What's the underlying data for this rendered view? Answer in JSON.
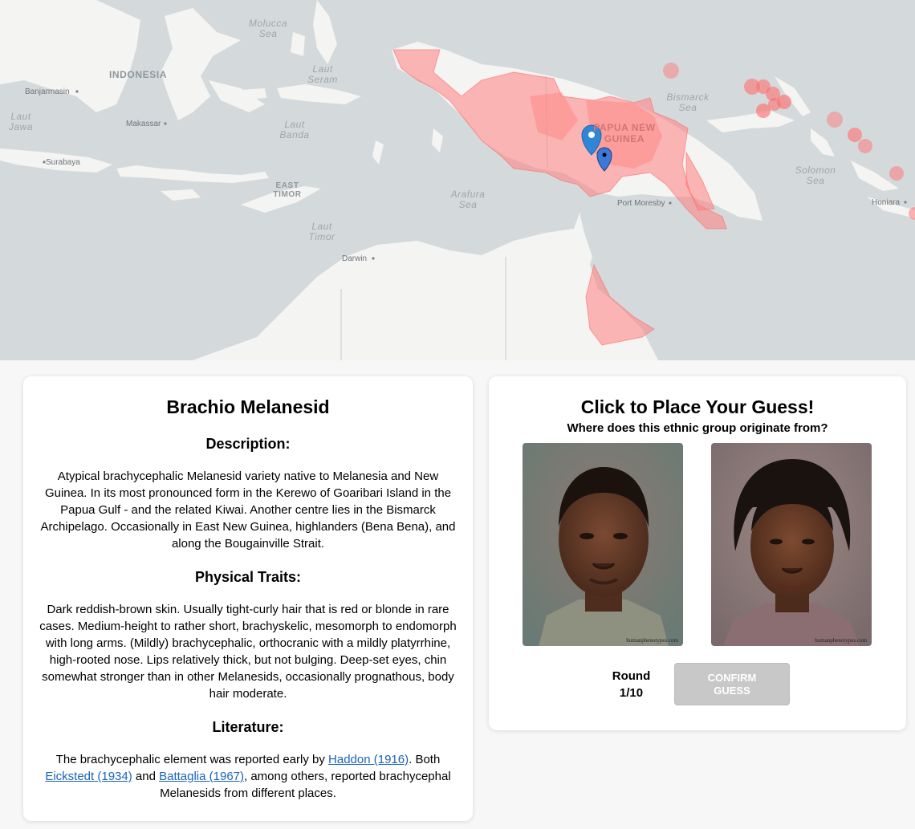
{
  "map": {
    "labels": {
      "molucca": "Molucca\nSea",
      "indonesia": "INDONESIA",
      "banjarmasin": "Banjarmasin",
      "laut_jawa": "Laut\nJawa",
      "makassar": "Makassar",
      "laut_seram": "Laut\nSeram",
      "laut_banda": "Laut\nBanda",
      "surabaya": "Surabaya",
      "east_timor": "EAST\nTIMOR",
      "laut_timor": "Laut\nTimor",
      "arafura": "Arafura\nSea",
      "darwin": "Darwin",
      "png": "PAPUA NEW\nGUINEA",
      "bismarck": "Bismarck\nSea",
      "solomon": "Solomon\nSea",
      "port_moresby": "Port Moresby",
      "honiara": "Honiara"
    },
    "region_color": "#ff8080",
    "marker_color": "#2f86d6"
  },
  "info": {
    "title": "Brachio Melanesid",
    "description_heading": "Description:",
    "description": "Atypical brachycephalic Melanesid variety native to Melanesia and New Guinea. In its most pronounced form in the Kerewo of Goaribari Island in the Papua Gulf - and the related Kiwai. Another centre lies in the Bismarck Archipelago. Occasionally in East New Guinea, highlanders (Bena Bena), and along the Bougainville Strait.",
    "traits_heading": "Physical Traits:",
    "traits": "Dark reddish-brown skin. Usually tight-curly hair that is red or blonde in rare cases. Medium-height to rather short, brachyskelic, mesomorph to endomorph with long arms. (Mildly) brachycephalic, orthocranic with a mildly platyrrhine, high-rooted nose. Lips relatively thick, but not bulging. Deep-set eyes, chin somewhat stronger than in other Melanesids, occasionally prognathous, body hair moderate.",
    "literature_heading": "Literature:",
    "literature": {
      "part1": "The brachycephalic element was reported early by ",
      "link1": "Haddon (1916)",
      "part2": ". Both ",
      "link2": "Eickstedt (1934)",
      "part3": " and ",
      "link3": "Battaglia (1967)",
      "part4": ", among others, reported brachycephal Melanesids from different places."
    }
  },
  "guess": {
    "title": "Click to Place Your Guess!",
    "subtitle": "Where does this ethnic group originate from?",
    "photo_watermark": "humanphenotypes.com",
    "round_label": "Round",
    "round_value": "1/10",
    "confirm_label": "CONFIRM\nGUESS"
  }
}
